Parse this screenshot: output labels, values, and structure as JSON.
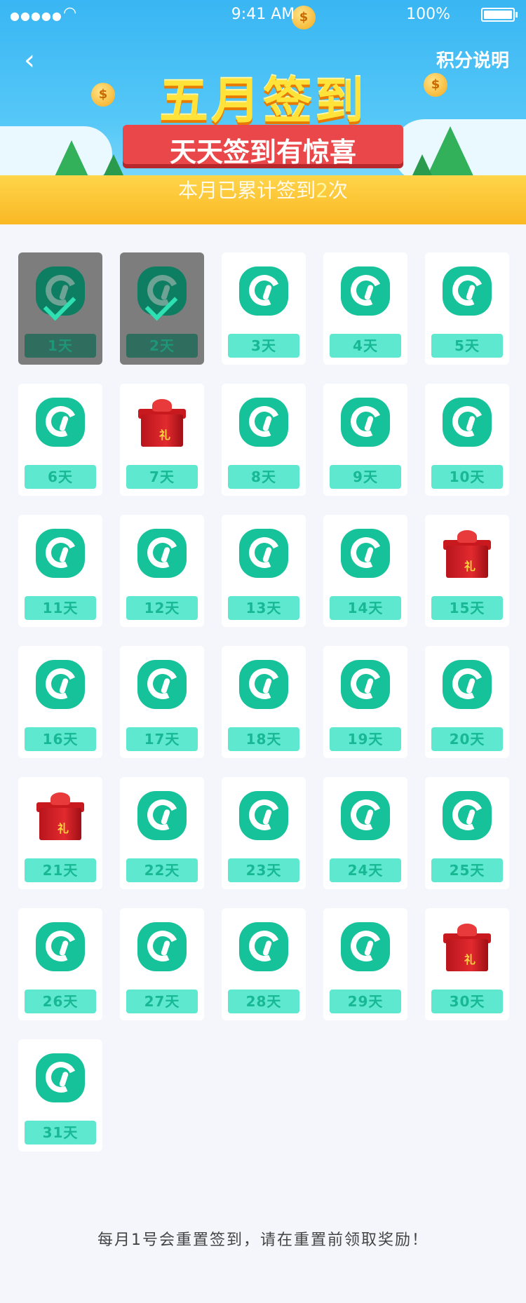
{
  "status_bar": {
    "signal": "●●●●●",
    "time": "9:41 AM",
    "battery": "100%"
  },
  "header": {
    "back_icon": "chevron-left-icon",
    "rules_link": "积分说明",
    "title": "五月签到",
    "ribbon": "天天签到有惊喜",
    "progress_prefix": "本月已累计签到",
    "progress_count": "2",
    "progress_suffix": "次"
  },
  "days": [
    {
      "label": "1天",
      "reward": "app",
      "checked": true
    },
    {
      "label": "2天",
      "reward": "app",
      "checked": true
    },
    {
      "label": "3天",
      "reward": "app",
      "checked": false
    },
    {
      "label": "4天",
      "reward": "app",
      "checked": false
    },
    {
      "label": "5天",
      "reward": "app",
      "checked": false
    },
    {
      "label": "6天",
      "reward": "app",
      "checked": false
    },
    {
      "label": "7天",
      "reward": "gift",
      "checked": false
    },
    {
      "label": "8天",
      "reward": "app",
      "checked": false
    },
    {
      "label": "9天",
      "reward": "app",
      "checked": false
    },
    {
      "label": "10天",
      "reward": "app",
      "checked": false
    },
    {
      "label": "11天",
      "reward": "app",
      "checked": false
    },
    {
      "label": "12天",
      "reward": "app",
      "checked": false
    },
    {
      "label": "13天",
      "reward": "app",
      "checked": false
    },
    {
      "label": "14天",
      "reward": "app",
      "checked": false
    },
    {
      "label": "15天",
      "reward": "gift",
      "checked": false
    },
    {
      "label": "16天",
      "reward": "app",
      "checked": false
    },
    {
      "label": "17天",
      "reward": "app",
      "checked": false
    },
    {
      "label": "18天",
      "reward": "app",
      "checked": false
    },
    {
      "label": "19天",
      "reward": "app",
      "checked": false
    },
    {
      "label": "20天",
      "reward": "app",
      "checked": false
    },
    {
      "label": "21天",
      "reward": "gift",
      "checked": false
    },
    {
      "label": "22天",
      "reward": "app",
      "checked": false
    },
    {
      "label": "23天",
      "reward": "app",
      "checked": false
    },
    {
      "label": "24天",
      "reward": "app",
      "checked": false
    },
    {
      "label": "25天",
      "reward": "app",
      "checked": false
    },
    {
      "label": "26天",
      "reward": "app",
      "checked": false
    },
    {
      "label": "27天",
      "reward": "app",
      "checked": false
    },
    {
      "label": "28天",
      "reward": "app",
      "checked": false
    },
    {
      "label": "29天",
      "reward": "app",
      "checked": false
    },
    {
      "label": "30天",
      "reward": "gift",
      "checked": false
    },
    {
      "label": "31天",
      "reward": "app",
      "checked": false
    }
  ],
  "gift_tag": "礼",
  "footer_note": "每月1号会重置签到，请在重置前领取奖励！",
  "colors": {
    "accent": "#16c29a",
    "pill": "#5de8cf",
    "banner": "#39b6f3",
    "gift": "#e12a2f"
  }
}
